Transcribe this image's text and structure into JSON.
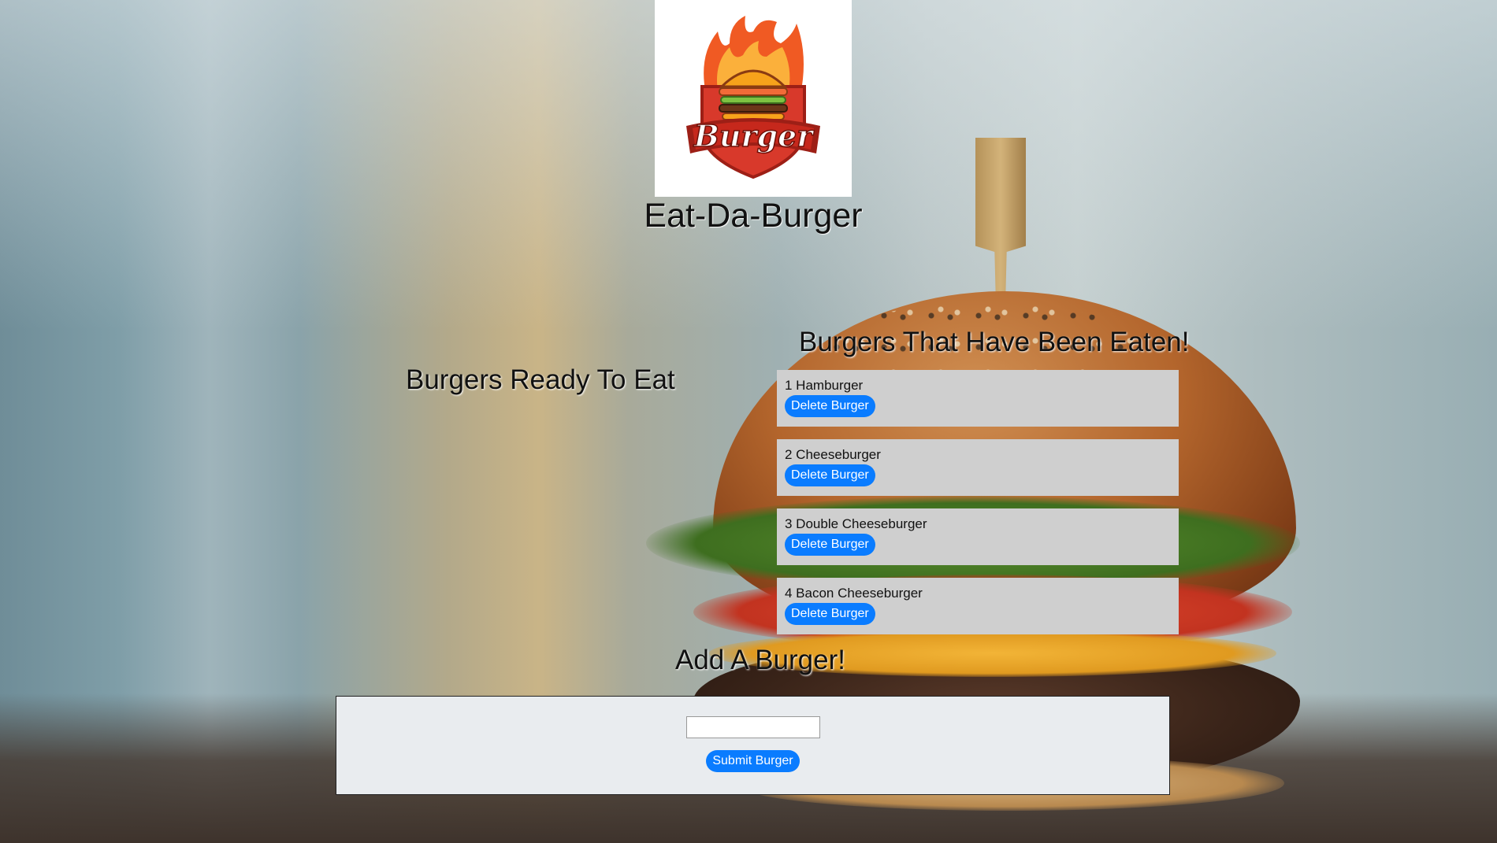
{
  "logo": {
    "text": "Burger",
    "icon": "burger-logo-icon"
  },
  "site_title": "Eat-Da-Burger",
  "ready": {
    "title": "Burgers Ready To Eat"
  },
  "eaten": {
    "title": "Burgers That Have Been Eaten!",
    "items": [
      {
        "label": "1 Hamburger",
        "button": "Delete Burger"
      },
      {
        "label": "2 Cheeseburger",
        "button": "Delete Burger"
      },
      {
        "label": "3 Double Cheeseburger",
        "button": "Delete Burger"
      },
      {
        "label": "4 Bacon Cheeseburger",
        "button": "Delete Burger"
      }
    ]
  },
  "add": {
    "title": "Add A Burger!",
    "input_value": "",
    "input_placeholder": "",
    "submit_label": "Submit Burger"
  },
  "colors": {
    "button": "#0a7cff",
    "card": "#cfcfcf",
    "form": "#e9ecef"
  }
}
